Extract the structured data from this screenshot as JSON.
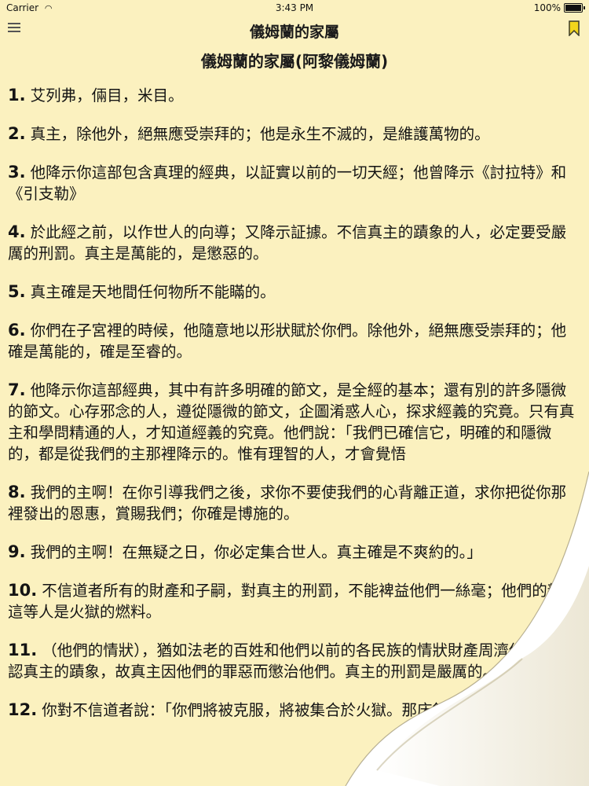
{
  "status_bar": {
    "carrier": "Carrier",
    "time": "3:43 PM",
    "battery": "100%"
  },
  "nav": {
    "title": "儀姆蘭的家屬",
    "menu_icon": "hamburger-menu-icon",
    "bookmark_icon": "bookmark-icon"
  },
  "surah_title": "儀姆蘭的家屬(阿黎儀姆蘭)",
  "verses": [
    {
      "num": "1.",
      "text": "艾列弗，倆目，米目。"
    },
    {
      "num": "2.",
      "text": "真主，除他外，絕無應受崇拜的；他是永生不滅的，是維護萬物的。"
    },
    {
      "num": "3.",
      "text": "他降示你這部包含真理的經典，以証實以前的一切天經；他曾降示《討拉特》和《引支勒》"
    },
    {
      "num": "4.",
      "text": "於此經之前，以作世人的向導；又降示証據。不信真主的蹟象的人，必定要受嚴厲的刑罰。真主是萬能的，是懲惡的。"
    },
    {
      "num": "5.",
      "text": "真主確是天地間任何物所不能瞞的。"
    },
    {
      "num": "6.",
      "text": "你們在子宮裡的時候，他隨意地以形狀賦於你們。除他外，絕無應受崇拜的；他確是萬能的，確是至睿的。"
    },
    {
      "num": "7.",
      "text": "他降示你這部經典，其中有許多明確的節文，是全經的基本；還有別的許多隱微的節文。心存邪念的人，遵從隱微的節文，企圖淆惑人心，探求經義的究竟。只有真主和學問精通的人，才知道經義的究竟。他們說：「我們已確信它，明確的和隱微的，都是從我們的主那裡降示的。惟有理智的人，才會覺悟"
    },
    {
      "num": "8.",
      "text": "我們的主啊！在你引導我們之後，求你不要使我們的心背離正道，求你把從你那裡發出的恩惠，賞賜我們；你確是博施的。"
    },
    {
      "num": "9.",
      "text": "我們的主啊！在無疑之日，你必定集合世人。真主確是不爽約的。」"
    },
    {
      "num": "10.",
      "text": "不信道者所有的財產和子嗣，對真主的刑罰，不能裨益他們一絲毫；他們的親所這等人是火獄的燃料。"
    },
    {
      "num": "11.",
      "text": "（他們的情狀），猶如法老的百姓和他們以前的各民族的情狀財產周濟他他們否認真主的蹟象，故真主因他們的罪惡而懲治他們。真主的刑罰是嚴厲的。"
    },
    {
      "num": "12.",
      "text": "你對不信道者說：「你們將被克服，將被集合於火獄。那床舖真惡劣！」"
    }
  ]
}
